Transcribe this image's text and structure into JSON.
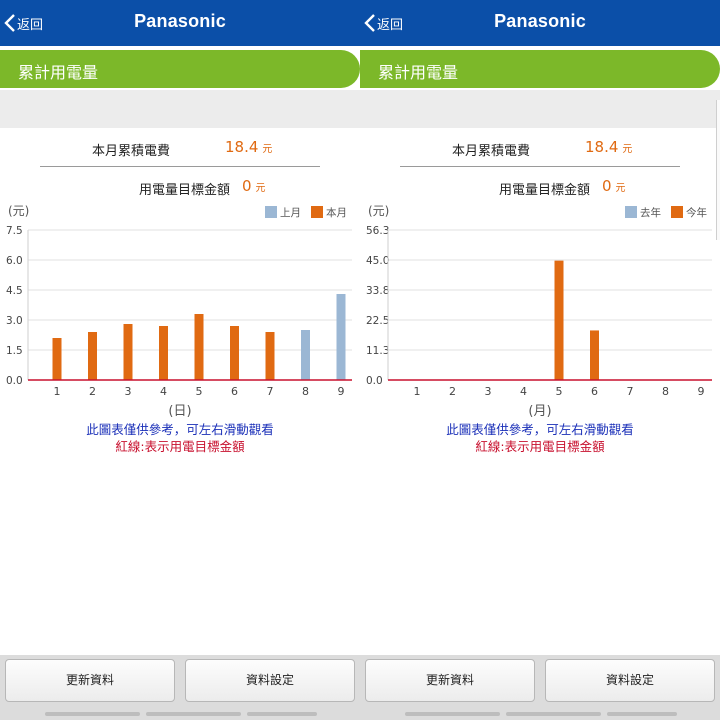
{
  "colors": {
    "header_blue": "#0b4fa8",
    "section_green": "#7cb829",
    "orange": "#e06a12",
    "blue_bar": "#9bb7d4",
    "note_blue": "#1a2fb8",
    "note_red": "#c8102e"
  },
  "panels": [
    {
      "header": {
        "back_label": "返回",
        "brand": "Panasonic"
      },
      "section_title": "累計用電量",
      "summary": {
        "cost_label": "本月累積電費",
        "cost_value": "18.4",
        "cost_unit": "元",
        "target_label": "用電量目標金額",
        "target_value": "0",
        "target_unit": "元"
      },
      "notes": {
        "line1": "此圖表僅供參考，可左右滑動觀看",
        "line2": "紅線:表示用電目標金額"
      },
      "footer": {
        "refresh_label": "更新資料",
        "settings_label": "資料設定"
      }
    },
    {
      "header": {
        "back_label": "返回",
        "brand": "Panasonic"
      },
      "section_title": "累計用電量",
      "summary": {
        "cost_label": "本月累積電費",
        "cost_value": "18.4",
        "cost_unit": "元",
        "target_label": "用電量目標金額",
        "target_value": "0",
        "target_unit": "元"
      },
      "notes": {
        "line1": "此圖表僅供參考，可左右滑動觀看",
        "line2": "紅線:表示用電目標金額"
      },
      "footer": {
        "refresh_label": "更新資料",
        "settings_label": "資料設定"
      }
    }
  ],
  "chart_data": [
    {
      "type": "bar",
      "ylabel": "(元)",
      "xlabel": "(日)",
      "categories": [
        "1",
        "2",
        "3",
        "4",
        "5",
        "6",
        "7",
        "8",
        "9"
      ],
      "yticks": [
        "7.5",
        "6.0",
        "4.5",
        "3.0",
        "1.5",
        "0.0"
      ],
      "ylim": [
        0,
        7.5
      ],
      "series": [
        {
          "name": "上月",
          "color": "#9bb7d4",
          "values": [
            null,
            null,
            null,
            null,
            null,
            null,
            null,
            2.5,
            4.3
          ]
        },
        {
          "name": "本月",
          "color": "#e06a12",
          "values": [
            2.1,
            2.4,
            2.8,
            2.7,
            3.3,
            2.7,
            2.4,
            null,
            null
          ]
        }
      ],
      "target_line": {
        "value": 0,
        "color": "#c8102e"
      },
      "legend_position": "top-right",
      "grid": true
    },
    {
      "type": "bar",
      "ylabel": "(元)",
      "xlabel": "(月)",
      "categories": [
        "1",
        "2",
        "3",
        "4",
        "5",
        "6",
        "7",
        "8",
        "9"
      ],
      "yticks": [
        "56.3",
        "45.0",
        "33.8",
        "22.5",
        "11.3",
        "0.0"
      ],
      "ylim": [
        0,
        56.3
      ],
      "series": [
        {
          "name": "去年",
          "color": "#9bb7d4",
          "values": [
            null,
            null,
            null,
            null,
            null,
            null,
            null,
            null,
            null
          ]
        },
        {
          "name": "今年",
          "color": "#e06a12",
          "values": [
            null,
            null,
            null,
            null,
            44.8,
            18.6,
            null,
            null,
            null
          ]
        }
      ],
      "target_line": {
        "value": 0,
        "color": "#c8102e"
      },
      "legend_position": "top-right",
      "grid": true
    }
  ]
}
